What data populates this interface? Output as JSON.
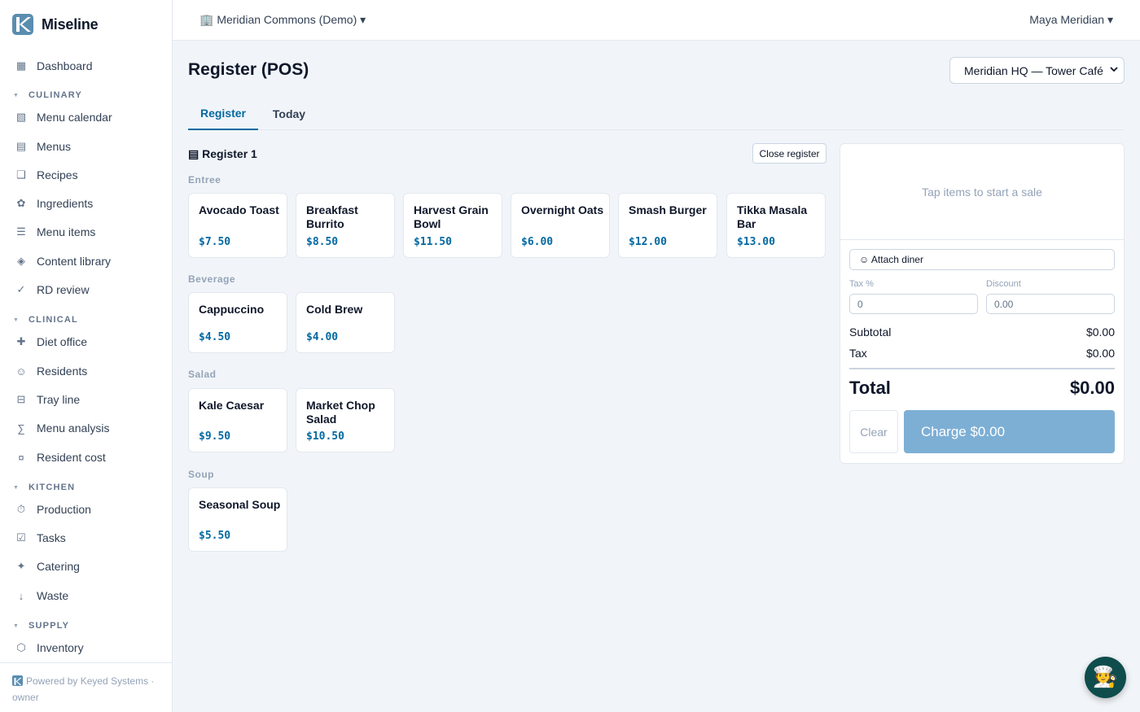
{
  "app": {
    "name": "Miseline"
  },
  "topbar": {
    "org_switch": "🏢 Meridian Commons (Demo) ▾",
    "user_menu": "Maya Meridian ▾"
  },
  "sidebar": {
    "items": [
      {
        "type": "item",
        "icon": "▦",
        "icon_name": "dashboard-icon",
        "label": "Dashboard"
      },
      {
        "type": "section",
        "label": "CULINARY"
      },
      {
        "type": "item",
        "icon": "▧",
        "icon_name": "calendar-icon",
        "label": "Menu calendar"
      },
      {
        "type": "item",
        "icon": "▤",
        "icon_name": "menus-icon",
        "label": "Menus"
      },
      {
        "type": "item",
        "icon": "❑",
        "icon_name": "recipes-icon",
        "label": "Recipes"
      },
      {
        "type": "item",
        "icon": "✿",
        "icon_name": "ingredients-icon",
        "label": "Ingredients"
      },
      {
        "type": "item",
        "icon": "☰",
        "icon_name": "menu-items-icon",
        "label": "Menu items"
      },
      {
        "type": "item",
        "icon": "◈",
        "icon_name": "content-library-icon",
        "label": "Content library"
      },
      {
        "type": "item",
        "icon": "✓",
        "icon_name": "check-icon",
        "label": "RD review"
      },
      {
        "type": "section",
        "label": "CLINICAL"
      },
      {
        "type": "item",
        "icon": "✚",
        "icon_name": "plus-icon",
        "label": "Diet office"
      },
      {
        "type": "item",
        "icon": "☺",
        "icon_name": "residents-icon",
        "label": "Residents"
      },
      {
        "type": "item",
        "icon": "⊟",
        "icon_name": "tray-icon",
        "label": "Tray line"
      },
      {
        "type": "item",
        "icon": "∑",
        "icon_name": "sigma-icon",
        "label": "Menu analysis"
      },
      {
        "type": "item",
        "icon": "¤",
        "icon_name": "cost-icon",
        "label": "Resident cost"
      },
      {
        "type": "section",
        "label": "KITCHEN"
      },
      {
        "type": "item",
        "icon": "⏱",
        "icon_name": "timer-icon",
        "label": "Production"
      },
      {
        "type": "item",
        "icon": "☑",
        "icon_name": "checkbox-icon",
        "label": "Tasks"
      },
      {
        "type": "item",
        "icon": "✦",
        "icon_name": "sparkle-icon",
        "label": "Catering"
      },
      {
        "type": "item",
        "icon": "↓",
        "icon_name": "arrow-down-icon",
        "label": "Waste"
      },
      {
        "type": "section",
        "label": "SUPPLY"
      },
      {
        "type": "item",
        "icon": "⬡",
        "icon_name": "inventory-icon",
        "label": "Inventory"
      }
    ],
    "footer_powered": "Powered by Keyed Systems ·",
    "footer_role": "owner"
  },
  "page": {
    "title": "Register (POS)",
    "location_select": "Meridian HQ — Tower Café",
    "tabs": [
      "Register",
      "Today"
    ]
  },
  "register": {
    "title": "▤ Register 1",
    "close_label": "Close register",
    "categories": [
      {
        "name": "Entree",
        "items": [
          {
            "name": "Avocado Toast",
            "price": "$7.50"
          },
          {
            "name": "Breakfast Burrito",
            "price": "$8.50"
          },
          {
            "name": "Harvest Grain Bowl",
            "price": "$11.50"
          },
          {
            "name": "Overnight Oats",
            "price": "$6.00"
          },
          {
            "name": "Smash Burger",
            "price": "$12.00"
          },
          {
            "name": "Tikka Masala Bar",
            "price": "$13.00"
          }
        ]
      },
      {
        "name": "Beverage",
        "items": [
          {
            "name": "Cappuccino",
            "price": "$4.50"
          },
          {
            "name": "Cold Brew",
            "price": "$4.00"
          }
        ]
      },
      {
        "name": "Salad",
        "items": [
          {
            "name": "Kale Caesar",
            "price": "$9.50"
          },
          {
            "name": "Market Chop Salad",
            "price": "$10.50"
          }
        ]
      },
      {
        "name": "Soup",
        "items": [
          {
            "name": "Seasonal Soup",
            "price": "$5.50"
          }
        ]
      }
    ]
  },
  "cart": {
    "empty_text": "Tap items to start a sale",
    "attach_diner": "☺ Attach diner",
    "tax_label": "Tax %",
    "tax_value": "0",
    "discount_label": "Discount",
    "discount_value": "0.00",
    "subtotal_label": "Subtotal",
    "subtotal_value": "$0.00",
    "tax_row_label": "Tax",
    "tax_row_value": "$0.00",
    "total_label": "Total",
    "total_value": "$0.00",
    "clear_label": "Clear",
    "charge_label": "Charge $0.00"
  },
  "fab": {
    "icon": "🧑‍🍳",
    "icon_name": "chef-icon"
  },
  "colors": {
    "accent": "#0369a1",
    "brand": "#5b8db0",
    "charge": "#7dafd5",
    "fab": "#0f4c4c"
  }
}
